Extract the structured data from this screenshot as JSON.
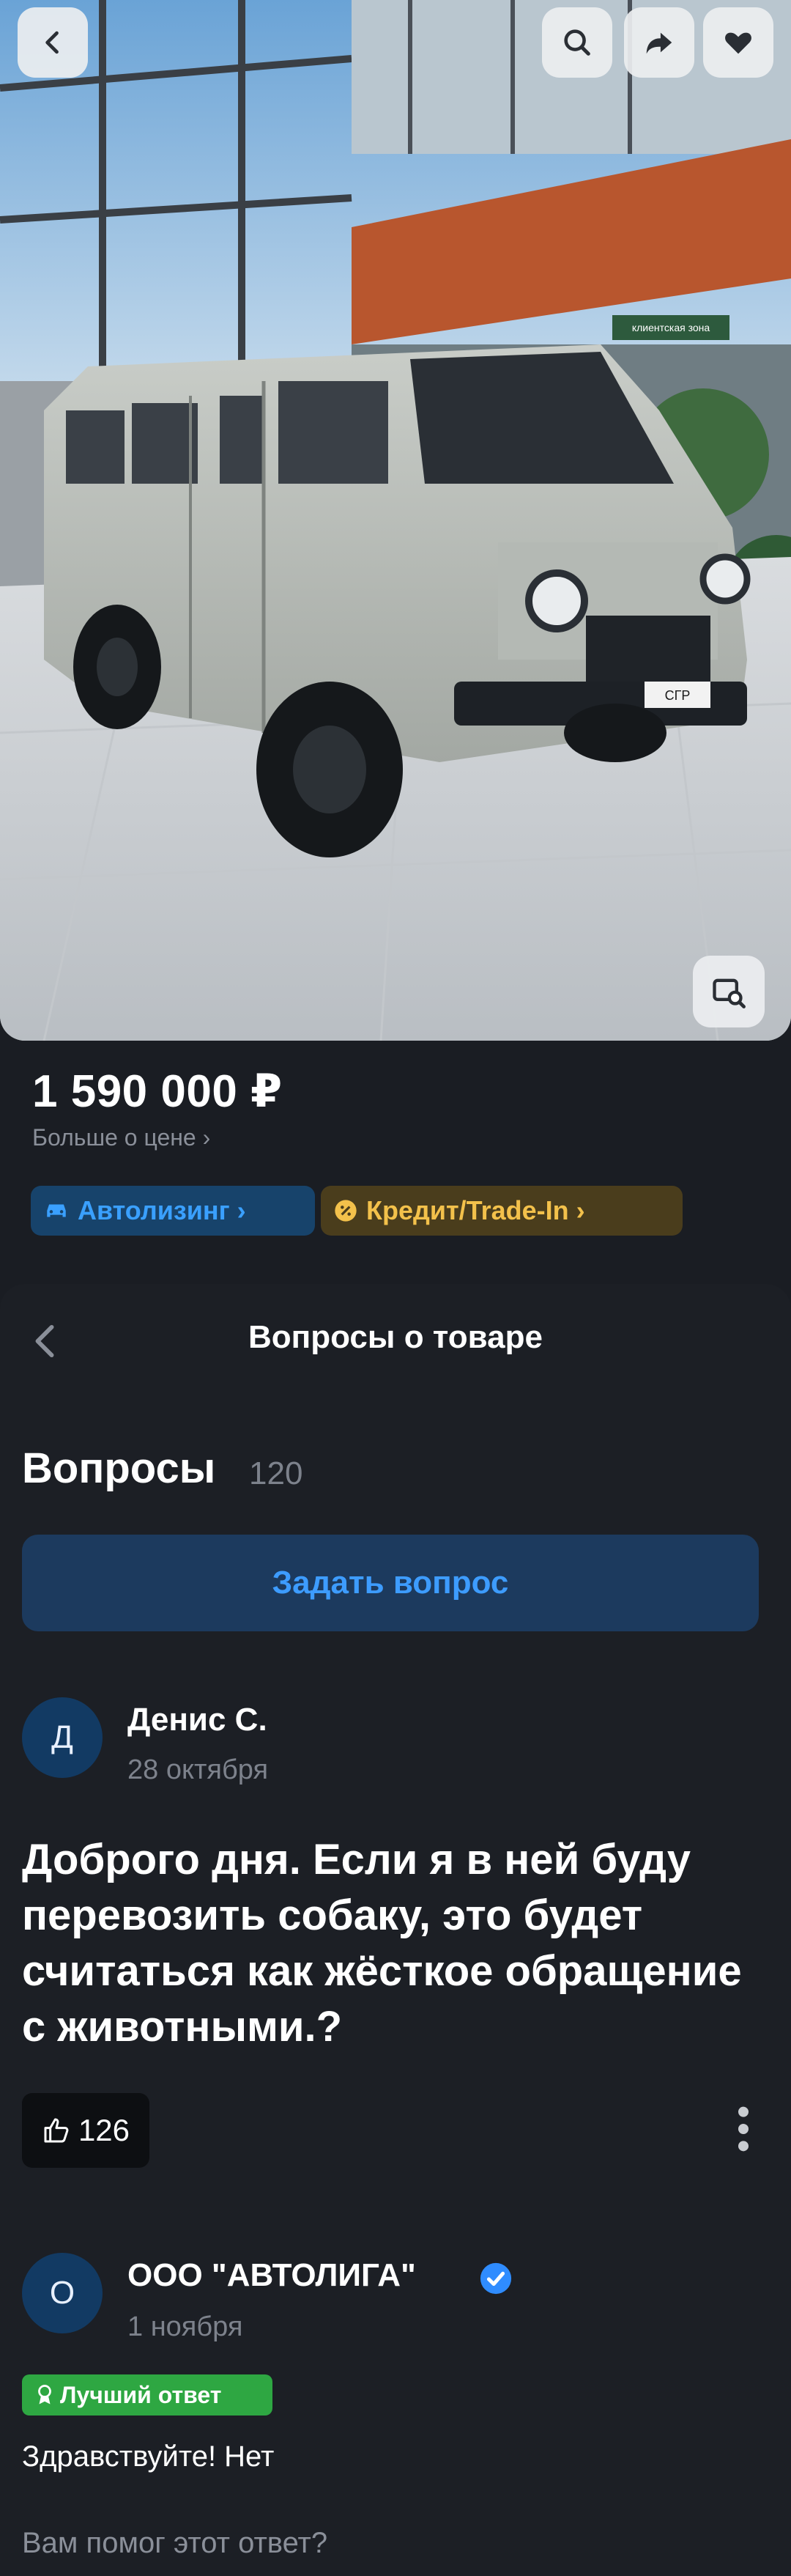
{
  "product": {
    "price": "1 590 000 ₽",
    "more_price": "Больше о цене ›",
    "leasing_label": "Автолизинг ›",
    "credit_label": "Кредит/Trade-In ›",
    "photo_signage": "клиентская зона",
    "plate_text": "СГР"
  },
  "questions": {
    "sheet_title": "Вопросы о товаре",
    "heading": "Вопросы",
    "count": "120",
    "ask_button": "Задать вопрос",
    "item": {
      "author_initial": "Д",
      "author": "Денис С.",
      "date": "28 октября",
      "text": "Доброго дня. Если я в ней буду перевозить собаку, это будет считаться как жёсткое обращение с животными.?",
      "likes": "126"
    },
    "answer": {
      "author_initial": "О",
      "author": "ООО \"АВТОЛИГА\"",
      "date": "1 ноября",
      "badge": "Лучший ответ",
      "text": "Здравствуйте! Нет",
      "helpful_prompt": "Вам помог этот ответ?"
    }
  },
  "icons": [
    "back-icon",
    "search-icon",
    "share-icon",
    "heart-icon",
    "image-search-icon",
    "car-icon",
    "percent-icon",
    "thumbs-up-icon",
    "kebab-menu-icon",
    "verified-icon",
    "award-icon"
  ],
  "colors": {
    "background": "#1a1d23",
    "blue_accent": "#3d9cff",
    "gold_accent": "#f3c14b",
    "best_answer_green": "#2ea742"
  }
}
